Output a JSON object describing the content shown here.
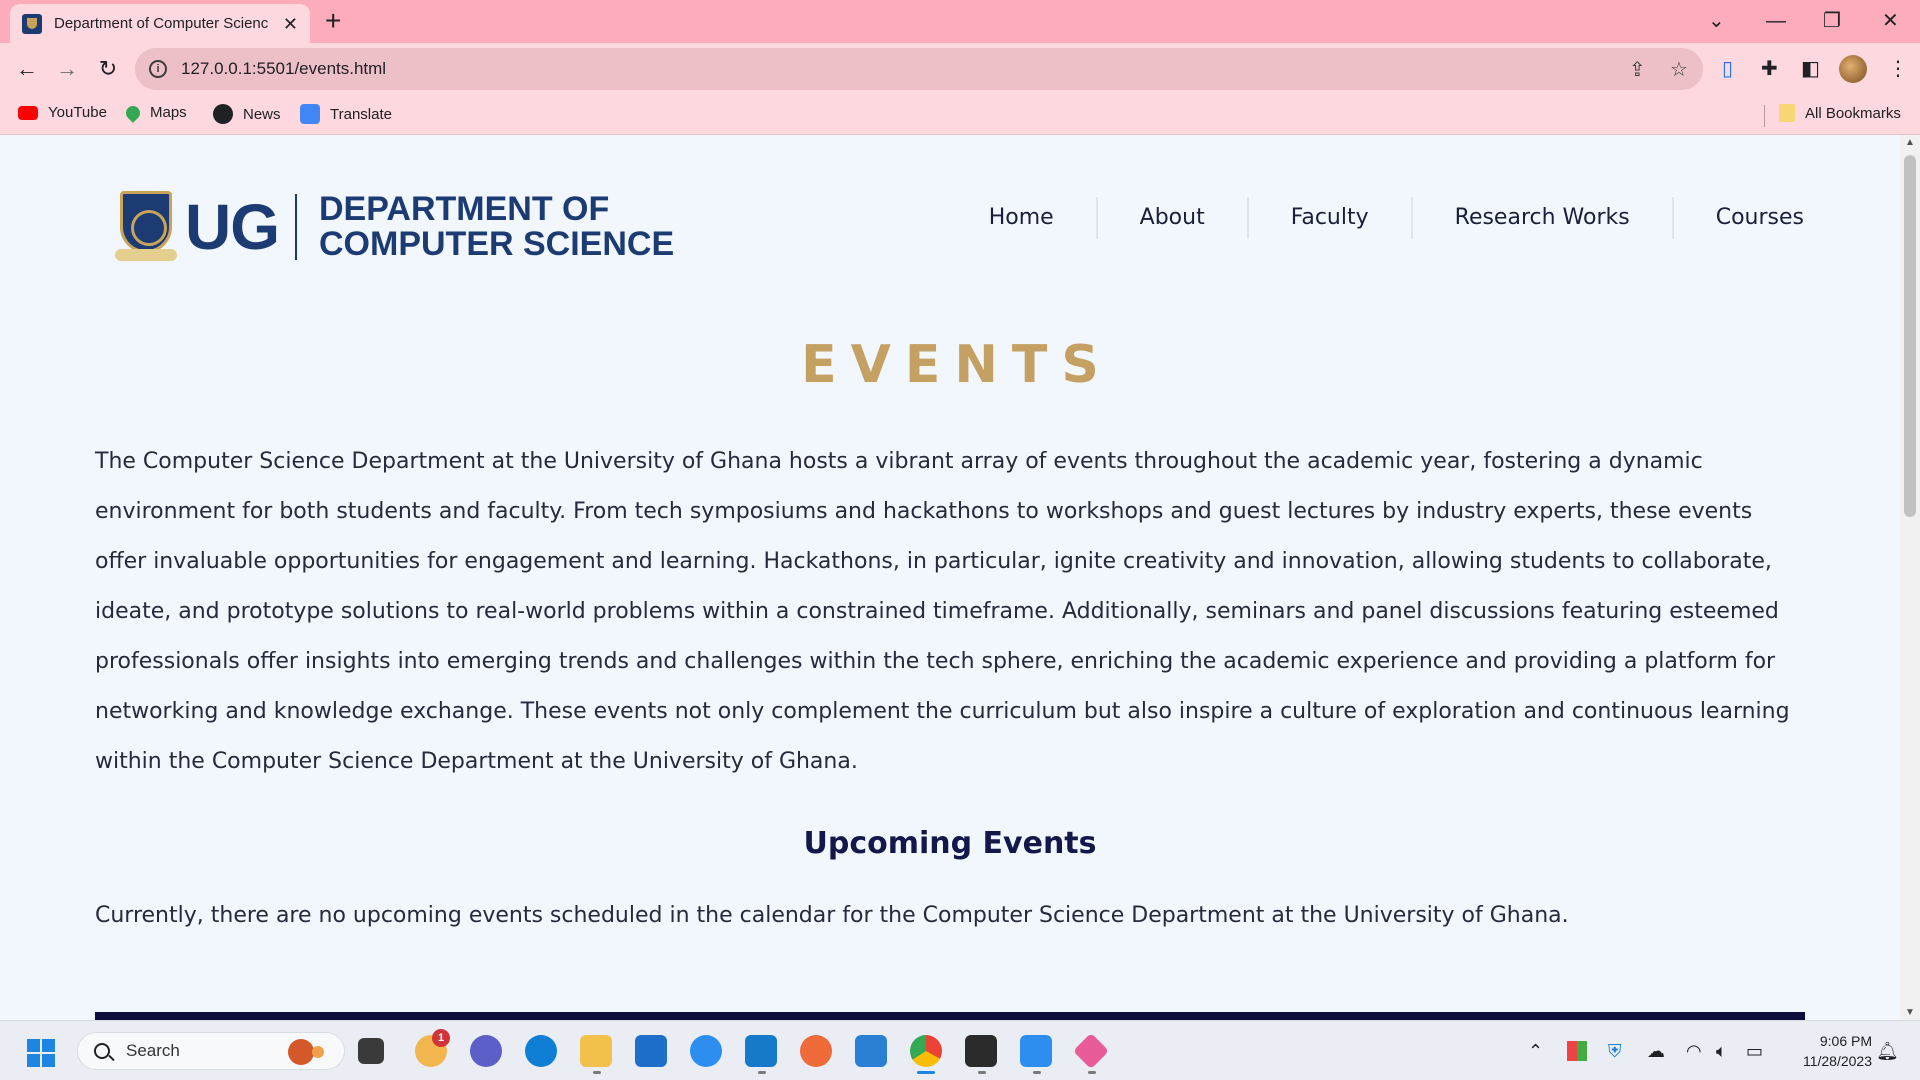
{
  "browser": {
    "tab_title": "Department of Computer Scienc",
    "url": "127.0.0.1:5501/events.html",
    "bookmarks": [
      "YouTube",
      "Maps",
      "News",
      "Translate"
    ],
    "all_bookmarks": "All Bookmarks"
  },
  "site": {
    "logo_ug": "UG",
    "logo_line1": "DEPARTMENT OF",
    "logo_line2": "COMPUTER SCIENCE",
    "nav": [
      "Home",
      "About",
      "Faculty",
      "Research Works",
      "Courses"
    ]
  },
  "page": {
    "title": "EVENTS",
    "intro": "The Computer Science Department at the University of Ghana hosts a vibrant array of events throughout the academic year, fostering a dynamic environment for both students and faculty. From tech symposiums and hackathons to workshops and guest lectures by industry experts, these events offer invaluable opportunities for engagement and learning. Hackathons, in particular, ignite creativity and innovation, allowing students to collaborate, ideate, and prototype solutions to real-world problems within a constrained timeframe. Additionally, seminars and panel discussions featuring esteemed professionals offer insights into emerging trends and challenges within the tech sphere, enriching the academic experience and providing a platform for networking and knowledge exchange. These events not only complement the curriculum but also inspire a culture of exploration and continuous learning within the Computer Science Department at the University of Ghana.",
    "upcoming_title": "Upcoming Events",
    "upcoming_text": "Currently, there are no upcoming events scheduled in the calendar for the Computer Science Department at the University of Ghana."
  },
  "taskbar": {
    "search_placeholder": "Search",
    "notification_badge": "1",
    "time": "9:06 PM",
    "date": "11/28/2023"
  },
  "colors": {
    "tabbar": "#fdacbb",
    "toolbar": "#fdd8de",
    "page_bg": "#f1f7fc",
    "brand_navy": "#1d3b73",
    "events_gold": "#c4a062",
    "heading_navy": "#13174a"
  }
}
